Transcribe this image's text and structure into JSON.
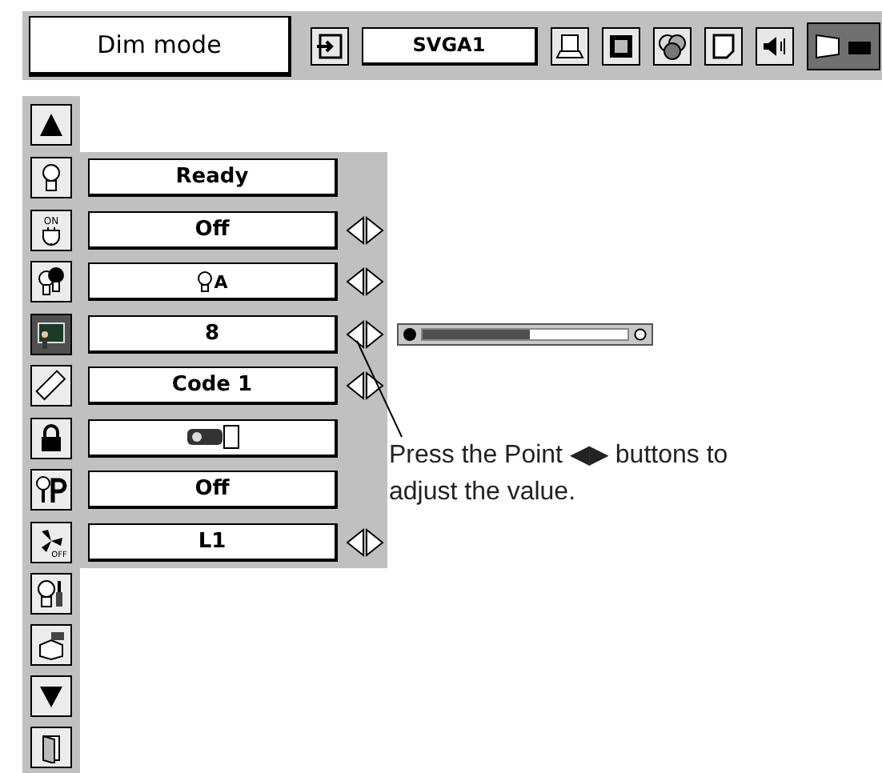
{
  "header": {
    "title": "Dim mode",
    "source": "SVGA1",
    "tools": [
      {
        "kind": "computer",
        "selected": false
      },
      {
        "kind": "frame",
        "selected": false
      },
      {
        "kind": "color",
        "selected": false
      },
      {
        "kind": "page",
        "selected": false
      },
      {
        "kind": "sound",
        "selected": false
      },
      {
        "kind": "screen",
        "selected": true
      }
    ]
  },
  "menu": {
    "items": [
      {
        "kind": "lamp",
        "value": "Ready",
        "arrows": false,
        "selected": false
      },
      {
        "kind": "power",
        "icon_text": "ON",
        "value": "Off",
        "arrows": true,
        "selected": false
      },
      {
        "kind": "lamps",
        "value_icon": {
          "kind": "lamp"
        },
        "value": "A",
        "arrows": true,
        "selected": false
      },
      {
        "kind": "picture",
        "value": "8",
        "arrows": true,
        "selected": true,
        "slider": {
          "level": 0.52
        }
      },
      {
        "kind": "remote",
        "value": "Code 1",
        "arrows": true,
        "selected": false
      },
      {
        "kind": "lock",
        "value_icon": {
          "kind": "projector"
        },
        "arrows": false,
        "selected": false
      },
      {
        "kind": "key",
        "value": "Off",
        "arrows": false,
        "selected": false
      },
      {
        "kind": "fan",
        "icon_text": "OFF",
        "value": "L1",
        "arrows": true,
        "selected": false
      }
    ],
    "extra": [
      {
        "kind": "lamp-tool"
      },
      {
        "kind": "box"
      },
      {
        "kind": "down"
      },
      {
        "kind": "exit"
      }
    ]
  },
  "note": "Press the Point ◀▶ buttons to adjust the value."
}
